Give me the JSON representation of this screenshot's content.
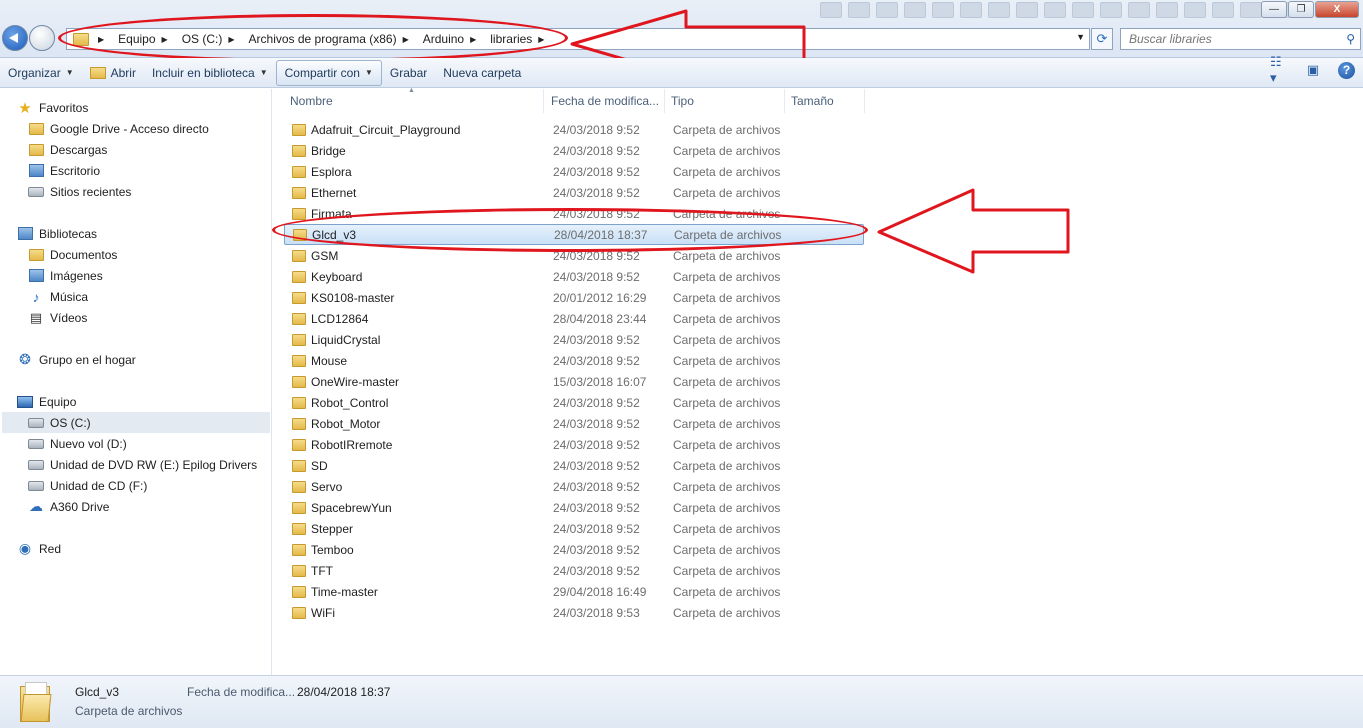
{
  "window": {
    "minimize": "—",
    "maximize": "❐",
    "close": "X"
  },
  "address": {
    "crumbs": [
      "Equipo",
      "OS (C:)",
      "Archivos de programa (x86)",
      "Arduino",
      "libraries"
    ]
  },
  "search": {
    "placeholder": "Buscar libraries"
  },
  "toolbar": {
    "organize": "Organizar",
    "open": "Abrir",
    "include": "Incluir en biblioteca",
    "share": "Compartir con",
    "burn": "Grabar",
    "new_folder": "Nueva carpeta"
  },
  "sidebar": {
    "favorites": {
      "label": "Favoritos",
      "items": [
        "Google Drive - Acceso directo",
        "Descargas",
        "Escritorio",
        "Sitios recientes"
      ]
    },
    "libraries": {
      "label": "Bibliotecas",
      "items": [
        "Documentos",
        "Imágenes",
        "Música",
        "Vídeos"
      ]
    },
    "homegroup": "Grupo en el hogar",
    "computer": {
      "label": "Equipo",
      "items": [
        "OS (C:)",
        "Nuevo vol (D:)",
        "Unidad de DVD RW (E:) Epilog Drivers",
        "Unidad de CD (F:)",
        "A360 Drive"
      ]
    },
    "network": "Red"
  },
  "columns": {
    "name": "Nombre",
    "date": "Fecha de modifica...",
    "type": "Tipo",
    "size": "Tamaño"
  },
  "files": [
    {
      "name": "Adafruit_Circuit_Playground",
      "date": "24/03/2018 9:52",
      "type": "Carpeta de archivos"
    },
    {
      "name": "Bridge",
      "date": "24/03/2018 9:52",
      "type": "Carpeta de archivos"
    },
    {
      "name": "Esplora",
      "date": "24/03/2018 9:52",
      "type": "Carpeta de archivos"
    },
    {
      "name": "Ethernet",
      "date": "24/03/2018 9:52",
      "type": "Carpeta de archivos"
    },
    {
      "name": "Firmata",
      "date": "24/03/2018 9:52",
      "type": "Carpeta de archivos"
    },
    {
      "name": "Glcd_v3",
      "date": "28/04/2018 18:37",
      "type": "Carpeta de archivos"
    },
    {
      "name": "GSM",
      "date": "24/03/2018 9:52",
      "type": "Carpeta de archivos"
    },
    {
      "name": "Keyboard",
      "date": "24/03/2018 9:52",
      "type": "Carpeta de archivos"
    },
    {
      "name": "KS0108-master",
      "date": "20/01/2012 16:29",
      "type": "Carpeta de archivos"
    },
    {
      "name": "LCD12864",
      "date": "28/04/2018 23:44",
      "type": "Carpeta de archivos"
    },
    {
      "name": "LiquidCrystal",
      "date": "24/03/2018 9:52",
      "type": "Carpeta de archivos"
    },
    {
      "name": "Mouse",
      "date": "24/03/2018 9:52",
      "type": "Carpeta de archivos"
    },
    {
      "name": "OneWire-master",
      "date": "15/03/2018 16:07",
      "type": "Carpeta de archivos"
    },
    {
      "name": "Robot_Control",
      "date": "24/03/2018 9:52",
      "type": "Carpeta de archivos"
    },
    {
      "name": "Robot_Motor",
      "date": "24/03/2018 9:52",
      "type": "Carpeta de archivos"
    },
    {
      "name": "RobotIRremote",
      "date": "24/03/2018 9:52",
      "type": "Carpeta de archivos"
    },
    {
      "name": "SD",
      "date": "24/03/2018 9:52",
      "type": "Carpeta de archivos"
    },
    {
      "name": "Servo",
      "date": "24/03/2018 9:52",
      "type": "Carpeta de archivos"
    },
    {
      "name": "SpacebrewYun",
      "date": "24/03/2018 9:52",
      "type": "Carpeta de archivos"
    },
    {
      "name": "Stepper",
      "date": "24/03/2018 9:52",
      "type": "Carpeta de archivos"
    },
    {
      "name": "Temboo",
      "date": "24/03/2018 9:52",
      "type": "Carpeta de archivos"
    },
    {
      "name": "TFT",
      "date": "24/03/2018 9:52",
      "type": "Carpeta de archivos"
    },
    {
      "name": "Time-master",
      "date": "29/04/2018 16:49",
      "type": "Carpeta de archivos"
    },
    {
      "name": "WiFi",
      "date": "24/03/2018 9:53",
      "type": "Carpeta de archivos"
    }
  ],
  "selected_index": 5,
  "details": {
    "name": "Glcd_v3",
    "type": "Carpeta de archivos",
    "date_label": "Fecha de modifica...",
    "date_value": "28/04/2018 18:37"
  },
  "annotation_color": "#e0161e"
}
